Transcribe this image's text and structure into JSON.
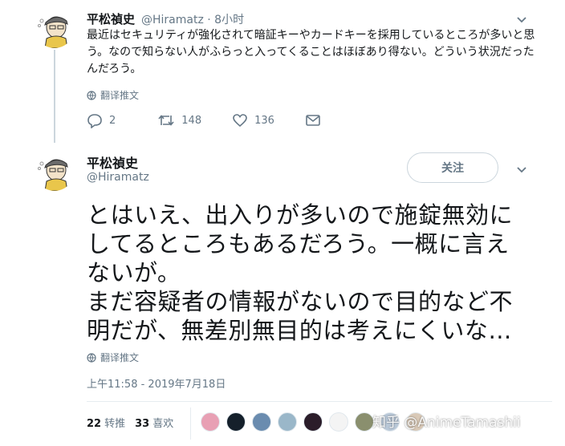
{
  "tweet1": {
    "name": "平松禎史",
    "handle": "@Hiramatz",
    "separator": "·",
    "time": "8小时",
    "text": "最近はセキュリティが強化されて暗証キーやカードキーを採用しているところが多いと思う。なので知らない人がふらっと入ってくることはほぼあり得ない。どういう状況だったんだろう。",
    "translate": "翻译推文",
    "replies": "2",
    "retweets": "148",
    "likes": "136"
  },
  "tweet2": {
    "name": "平松禎史",
    "handle": "@Hiramatz",
    "follow": "关注",
    "lines": [
      "とはいえ、出入りが多いので施錠無効に",
      "してるところもあるだろう。一概に言え",
      "ないが。",
      "まだ容疑者の情報がないので目的など不",
      "明だが、無差別無目的は考えにくいな…"
    ],
    "translate": "翻译推文",
    "timestamp": "上午11:58 - 2019年7月18日",
    "retweet_count": "22",
    "retweet_label": "转推",
    "like_count": "33",
    "like_label": "喜欢"
  },
  "watermark": "知乎 @AnimeTamashii",
  "colors": {
    "text": "#14171a",
    "muted": "#657786",
    "border": "#ccd6dd",
    "liker_colors": [
      "#e8a0b4",
      "#15202b",
      "#6a8caf",
      "#9ab7c9",
      "#2b1d2a",
      "#f4f4f4",
      "#8a8f6e",
      "#b9c8d8",
      "#d9c9b7"
    ]
  }
}
